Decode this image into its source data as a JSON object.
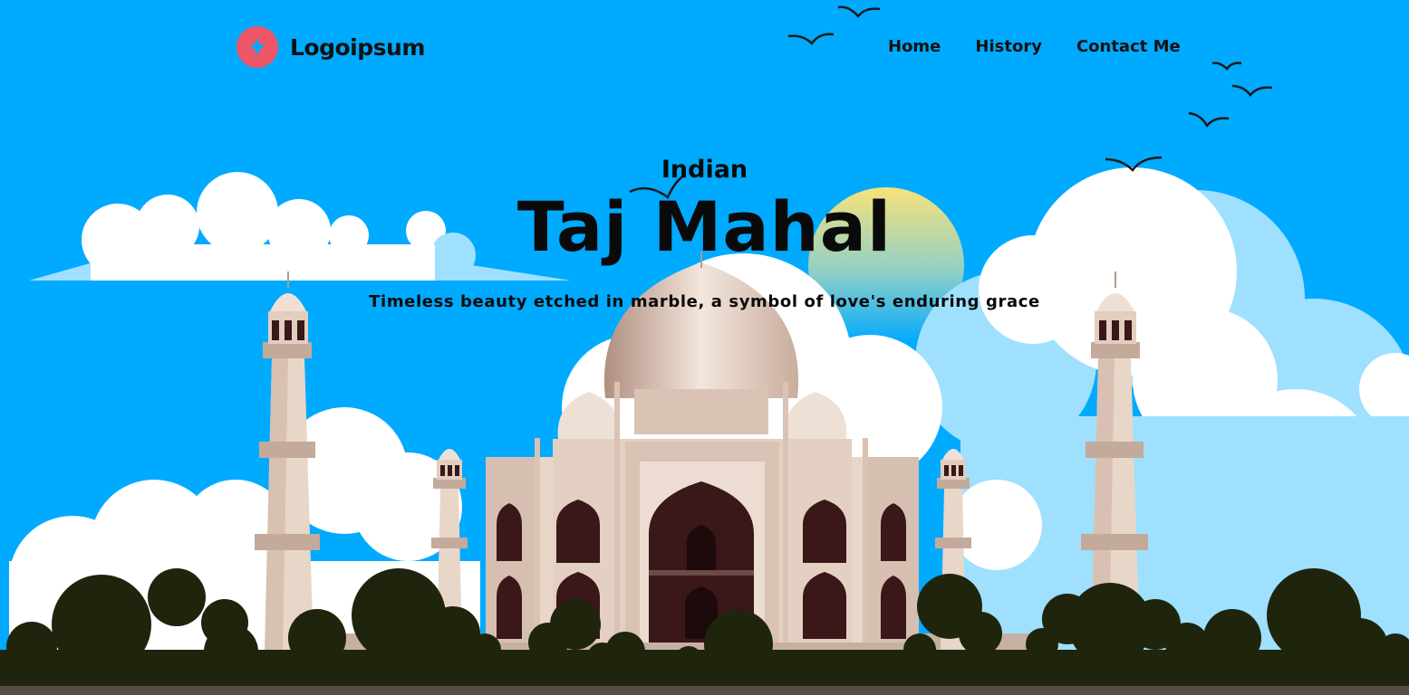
{
  "brand": {
    "name": "Logoipsum",
    "icon": "lightning-bolt-icon",
    "color": "#ee5566"
  },
  "nav": {
    "items": [
      {
        "label": "Home"
      },
      {
        "label": "History"
      },
      {
        "label": "Contact Me"
      }
    ]
  },
  "hero": {
    "eyebrow": "Indian",
    "title": "Taj Mahal",
    "tagline": "Timeless beauty etched in marble, a symbol of love's enduring grace"
  },
  "theme": {
    "sky": "#00aaff",
    "cloud": "#ffffff",
    "cloud_shade": "#9fe0ff",
    "trees": "#1f250c",
    "marble": "#e8d6c8"
  }
}
